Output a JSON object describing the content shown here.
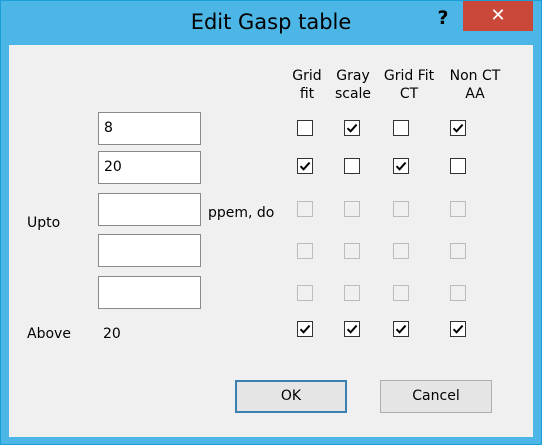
{
  "dialog": {
    "title": "Edit Gasp table",
    "help_symbol": "?",
    "close_symbol": "✕"
  },
  "labels": {
    "upto": "Upto",
    "above": "Above",
    "ppem_do": "ppem, do",
    "above_value": "20"
  },
  "columns": [
    {
      "label": "Grid\nfit"
    },
    {
      "label": "Gray\nscale"
    },
    {
      "label": "Grid Fit\nCT"
    },
    {
      "label": "Non CT\nAA"
    }
  ],
  "rows": [
    {
      "ppem": "8",
      "enabled": true,
      "checks": [
        false,
        true,
        false,
        true
      ]
    },
    {
      "ppem": "20",
      "enabled": true,
      "checks": [
        true,
        false,
        true,
        false
      ]
    },
    {
      "ppem": "",
      "enabled": false,
      "checks": [
        false,
        false,
        false,
        false
      ]
    },
    {
      "ppem": "",
      "enabled": false,
      "checks": [
        false,
        false,
        false,
        false
      ]
    },
    {
      "ppem": "",
      "enabled": false,
      "checks": [
        false,
        false,
        false,
        false
      ]
    },
    {
      "ppem": "above",
      "enabled": true,
      "checks": [
        true,
        true,
        true,
        true
      ]
    }
  ],
  "buttons": {
    "ok": "OK",
    "cancel": "Cancel"
  },
  "colors": {
    "title_bar": "#4cb6e6",
    "close_button": "#c9483a"
  }
}
